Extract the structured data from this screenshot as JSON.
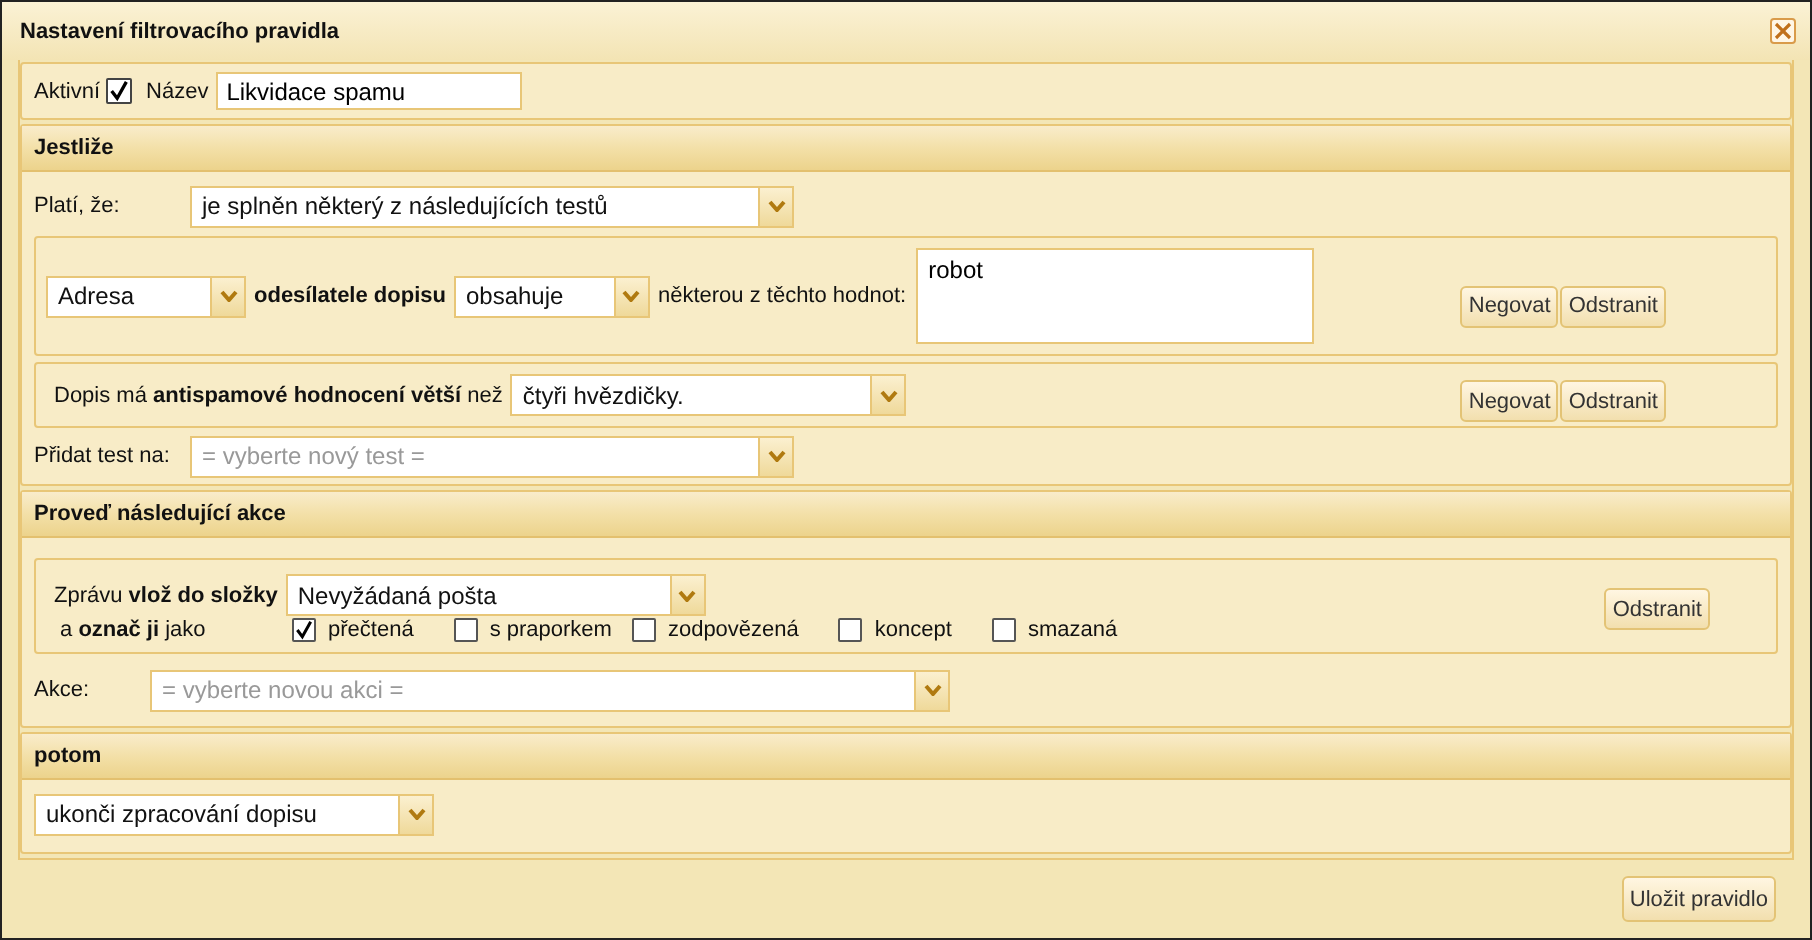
{
  "window": {
    "title": "Nastavení filtrovacího pravidla"
  },
  "general": {
    "active": {
      "label": "Aktivní",
      "checked": true
    },
    "name": {
      "label": "Název",
      "value": "Likvidace spamu"
    }
  },
  "conditions": {
    "heading": "Jestliže",
    "applies": {
      "label": "Platí, že:",
      "value": "je splněn některý z následujících testů"
    },
    "tests": [
      {
        "kind": "address",
        "field": "Adresa",
        "subject": "odesílatele dopisu",
        "operator": "obsahuje",
        "values_label": "některou z těchto hodnot:",
        "values": "robot",
        "buttons": [
          "Negovat",
          "Odstranit"
        ]
      },
      {
        "kind": "spam",
        "sentence": "Dopis má **antispamové hodnocení větší** než",
        "value": "čtyři hvězdičky.",
        "buttons": [
          "Negovat",
          "Odstranit"
        ]
      }
    ],
    "add_test": {
      "label": "Přidat test na:",
      "placeholder": "= vyberte nový test ="
    }
  },
  "actions": {
    "heading": "Proveď následující akce",
    "items": [
      {
        "kind": "move",
        "label": "Zprávu **vlož do složky**",
        "folder": "Nevyžádaná pošta",
        "mark_label": "a **označ ji** jako",
        "flags": [
          {
            "label": "přečtená",
            "checked": true
          },
          {
            "label": "s praporkem",
            "checked": false
          },
          {
            "label": "zodpovězená",
            "checked": false
          },
          {
            "label": "koncept",
            "checked": false
          },
          {
            "label": "smazaná",
            "checked": false
          }
        ],
        "button": "Odstranit"
      }
    ],
    "add_action": {
      "label": "Akce:",
      "placeholder": "= vyberte novou akci ="
    }
  },
  "then": {
    "heading": "potom",
    "value": "ukonči zpracování dopisu"
  },
  "save_button": "Uložit pravidlo"
}
